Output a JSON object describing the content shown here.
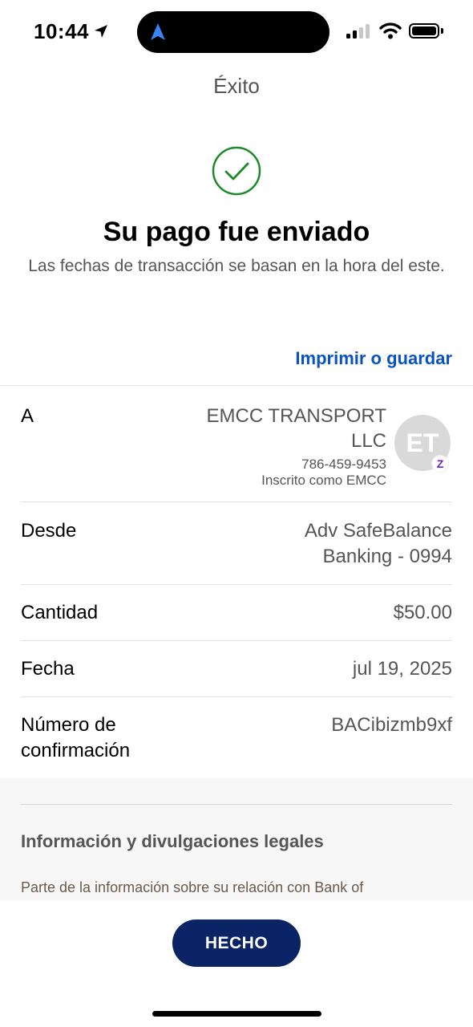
{
  "status_bar": {
    "time": "10:44",
    "icons": [
      "location-arrow-icon",
      "navigation-arrow-icon",
      "signal-icon",
      "wifi-icon",
      "battery-icon"
    ]
  },
  "header": {
    "title": "Éxito"
  },
  "success": {
    "icon": "checkmark-circle-icon",
    "headline": "Su pago fue enviado",
    "subline": "Las fechas de transacción se basan en la hora del este."
  },
  "actions": {
    "print_label": "Imprimir o guardar"
  },
  "details": {
    "to": {
      "label": "A",
      "name_line1": "EMCC TRANSPORT",
      "name_line2": "LLC",
      "phone": "786-459-9453",
      "enrolled": "Inscrito como EMCC",
      "avatar_initials": "ET",
      "badge": "Z"
    },
    "from": {
      "label": "Desde",
      "value_line1": "Adv SafeBalance",
      "value_line2": "Banking - 0994"
    },
    "amount": {
      "label": "Cantidad",
      "value": "$50.00"
    },
    "date": {
      "label": "Fecha",
      "value": "jul 19, 2025"
    },
    "confirmation": {
      "label_line1": "Número de",
      "label_line2": "confirmación",
      "value": "BACibizmb9xf"
    }
  },
  "legal": {
    "title": "Información y divulgaciones legales",
    "text": "Parte de la información sobre su relación con Bank of"
  },
  "footer": {
    "done_label": "HECHO"
  },
  "colors": {
    "accent_link": "#0a53be",
    "button": "#0b2466",
    "success": "#1f8a2a",
    "zelle": "#6d1ed4"
  }
}
